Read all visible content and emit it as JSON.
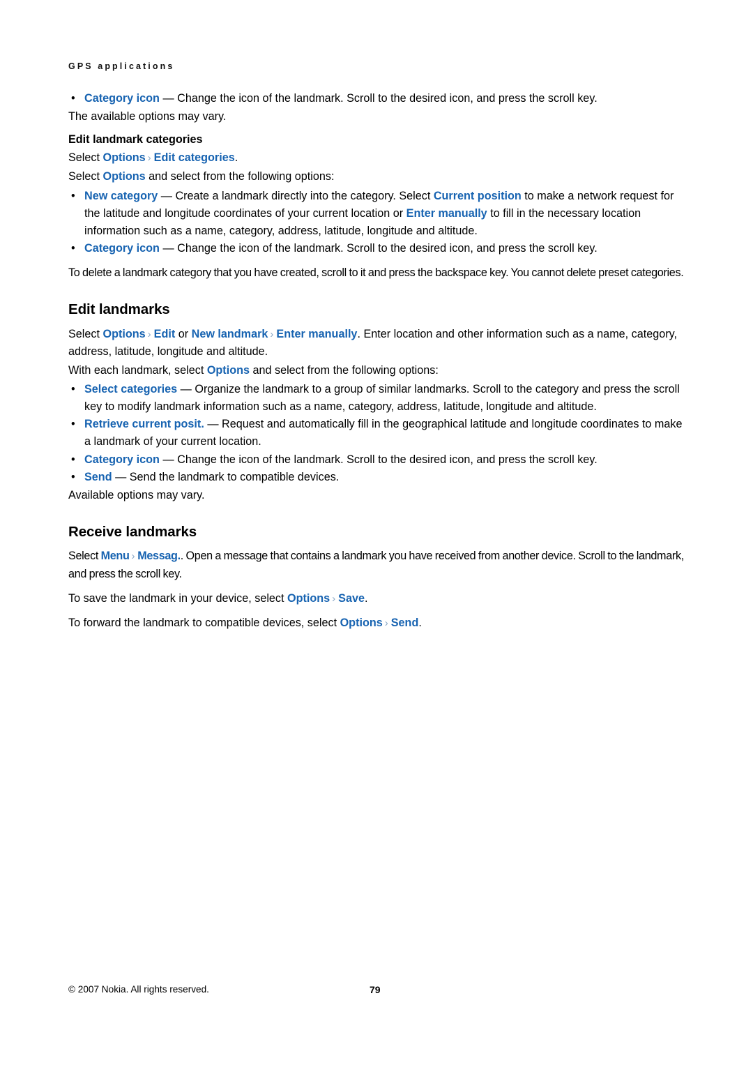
{
  "document": {
    "running_header": "GPS applications",
    "page_number": "79",
    "copyright": "© 2007 Nokia. All rights reserved.",
    "accent_color": "#1763b1",
    "chevron_color": "#8aa8c6",
    "chevron_glyph": "›"
  },
  "top_block": {
    "bullet_marker": "•",
    "category_icon_bullet": {
      "term": "Category icon",
      "rest": " — Change the icon of the landmark. Scroll to the desired icon, and press the scroll key."
    },
    "available_options": "The available options may vary."
  },
  "edit_landmark_categories": {
    "heading": "Edit landmark categories",
    "select_line": {
      "lead": "Select ",
      "ui1": "Options",
      "ui2": "Edit categories",
      "tail": "."
    },
    "intro": {
      "lead": "Select ",
      "ui1": "Options",
      "tail": " and select from the following options:"
    },
    "bullets": [
      {
        "term": "New category",
        "part1": " — Create a landmark directly into the category. Select ",
        "ui1": "Current position",
        "part2": " to make a network request for the latitude and longitude coordinates of your current location or ",
        "ui2": "Enter manually",
        "part3": " to fill in the necessary location information such as a name, category, address, latitude, longitude and altitude."
      },
      {
        "term": "Category icon",
        "part1": " — Change the icon of the landmark. Scroll to the desired icon, and press the scroll key."
      }
    ],
    "delete_note": "To delete a landmark category that you have created, scroll to it and press the backspace key. You cannot delete preset categories."
  },
  "edit_landmarks": {
    "heading": "Edit landmarks",
    "select_line": {
      "lead": "Select ",
      "ui1": "Options",
      "ui2": "Edit",
      "mid": " or ",
      "ui3": "New landmark",
      "ui4": "Enter manually",
      "tail": ". Enter location and other information such as a name, category, address, latitude, longitude and altitude."
    },
    "intro": {
      "lead": "With each landmark, select ",
      "ui1": "Options",
      "tail": " and select from the following options:"
    },
    "bullets": [
      {
        "term": "Select categories",
        "part1": " — Organize the landmark to a group of similar landmarks. Scroll to the category and press the scroll key to modify landmark information such as a name, category, address, latitude, longitude and altitude."
      },
      {
        "term": "Retrieve current posit.",
        "part1": " — Request and automatically fill in the geographical latitude and longitude coordinates to make a landmark of your current location."
      },
      {
        "term": "Category icon",
        "part1": " — Change the icon of the landmark. Scroll to the desired icon, and press the scroll key."
      },
      {
        "term": "Send",
        "part1": " — Send the landmark to compatible devices."
      }
    ],
    "available_options": "Available options may vary."
  },
  "receive_landmarks": {
    "heading": "Receive landmarks",
    "select_line": {
      "lead": "Select ",
      "ui1": "Menu",
      "ui2": "Messag.",
      "tail": ". Open a message that contains a landmark you have received from another device. Scroll to the landmark, and press the scroll key."
    },
    "save_line": {
      "lead": "To save the landmark in your device, select ",
      "ui1": "Options",
      "ui2": "Save",
      "tail": "."
    },
    "forward_line": {
      "lead": "To forward the landmark to compatible devices, select ",
      "ui1": "Options",
      "ui2": "Send",
      "tail": "."
    }
  }
}
